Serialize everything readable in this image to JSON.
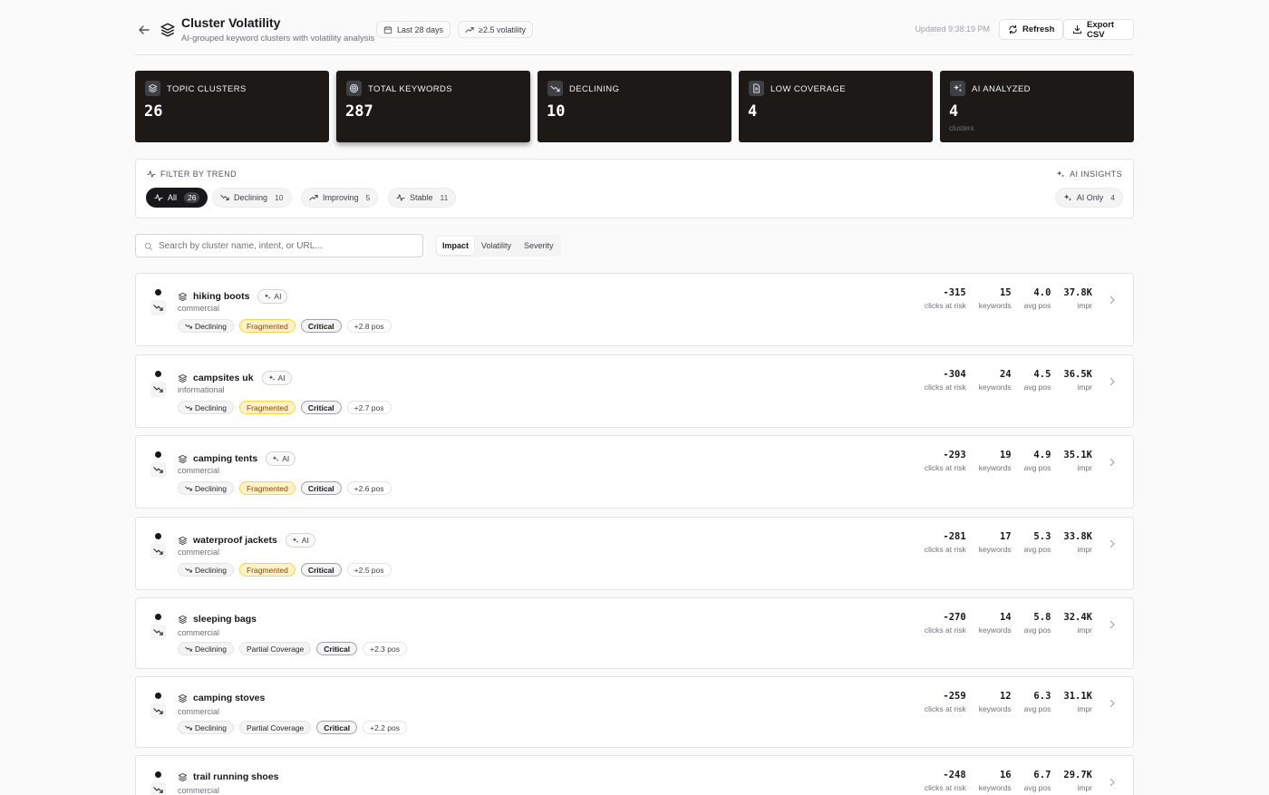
{
  "header": {
    "title": "Cluster Volatility",
    "subtitle": "AI-grouped keyword clusters with volatility analysis",
    "chip_range": "Last 28 days",
    "chip_volatility": "≥2.5 volatility",
    "updated": "Updated 9:38:19 PM",
    "refresh_label": "Refresh",
    "export_label": "Export CSV"
  },
  "stats": [
    {
      "label": "Topic Clusters",
      "value": "26",
      "icon": "layers-icon"
    },
    {
      "label": "Total Keywords",
      "value": "287",
      "icon": "target-icon"
    },
    {
      "label": "Declining",
      "value": "10",
      "icon": "trending-down-icon"
    },
    {
      "label": "Low Coverage",
      "value": "4",
      "icon": "document-icon"
    },
    {
      "label": "AI Analyzed",
      "value": "4",
      "icon": "sparkles-icon",
      "foot": "clusters"
    }
  ],
  "filter": {
    "title": "Filter by trend",
    "ai_title": "AI Insights",
    "pills": [
      {
        "label": "All",
        "count": "26"
      },
      {
        "label": "Declining",
        "count": "10"
      },
      {
        "label": "Improving",
        "count": "5"
      },
      {
        "label": "Stable",
        "count": "11"
      }
    ],
    "ai_only": {
      "label": "AI Only",
      "count": "4"
    }
  },
  "search": {
    "placeholder": "Search by cluster name, intent, or URL..."
  },
  "sort": [
    "Impact",
    "Volatility",
    "Severity"
  ],
  "metric_labels": {
    "clicks": "clicks at risk",
    "keywords": "keywords",
    "avg_pos": "avg pos",
    "impr": "impr"
  },
  "clusters": [
    {
      "name": "hiking boots",
      "ai": "AI",
      "intent": "commercial",
      "trend": "Declining",
      "coverage": "Fragmented",
      "severity": "Critical",
      "pos": "+2.8 pos",
      "clicks": "-315",
      "keywords": "15",
      "avg_pos": "4.0",
      "impr": "37.8K"
    },
    {
      "name": "campsites uk",
      "ai": "AI",
      "intent": "informational",
      "trend": "Declining",
      "coverage": "Fragmented",
      "severity": "Critical",
      "pos": "+2.7 pos",
      "clicks": "-304",
      "keywords": "24",
      "avg_pos": "4.5",
      "impr": "36.5K"
    },
    {
      "name": "camping tents",
      "ai": "AI",
      "intent": "commercial",
      "trend": "Declining",
      "coverage": "Fragmented",
      "severity": "Critical",
      "pos": "+2.6 pos",
      "clicks": "-293",
      "keywords": "19",
      "avg_pos": "4.9",
      "impr": "35.1K"
    },
    {
      "name": "waterproof jackets",
      "ai": "AI",
      "intent": "commercial",
      "trend": "Declining",
      "coverage": "Fragmented",
      "severity": "Critical",
      "pos": "+2.5 pos",
      "clicks": "-281",
      "keywords": "17",
      "avg_pos": "5.3",
      "impr": "33.8K"
    },
    {
      "name": "sleeping bags",
      "ai": "",
      "intent": "commercial",
      "trend": "Declining",
      "coverage": "Partial Coverage",
      "severity": "Critical",
      "pos": "+2.3 pos",
      "clicks": "-270",
      "keywords": "14",
      "avg_pos": "5.8",
      "impr": "32.4K"
    },
    {
      "name": "camping stoves",
      "ai": "",
      "intent": "commercial",
      "trend": "Declining",
      "coverage": "Partial Coverage",
      "severity": "Critical",
      "pos": "+2.2 pos",
      "clicks": "-259",
      "keywords": "12",
      "avg_pos": "6.3",
      "impr": "31.1K"
    },
    {
      "name": "trail running shoes",
      "ai": "",
      "intent": "commercial",
      "trend": "Declining",
      "coverage": "",
      "severity": "",
      "pos": "",
      "clicks": "-248",
      "keywords": "16",
      "avg_pos": "6.7",
      "impr": "29.7K"
    }
  ]
}
